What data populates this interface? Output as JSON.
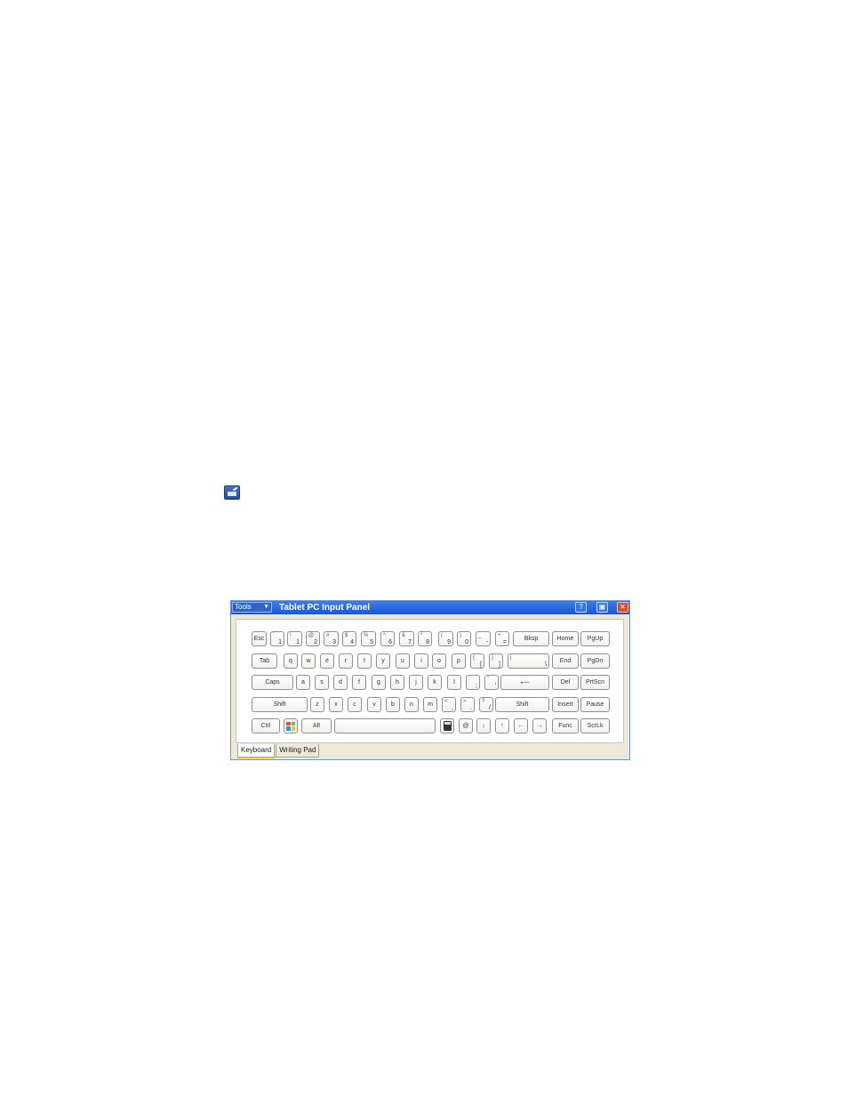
{
  "tray_icon": "input-panel-icon",
  "panel": {
    "tools_label": "Tools",
    "title": "Tablet PC Input Panel",
    "titlebar_buttons": [
      "help-icon",
      "dock-icon",
      "close-icon"
    ],
    "tabs": [
      {
        "label": "Keyboard",
        "active": true
      },
      {
        "label": "Writing Pad",
        "active": false
      }
    ]
  },
  "keyboard": {
    "row1": [
      {
        "label": "Esc"
      },
      {
        "label": "1",
        "shift": "`"
      },
      {
        "label": "1",
        "shift": "!"
      },
      {
        "label": "2",
        "shift": "@"
      },
      {
        "label": "3",
        "shift": "#"
      },
      {
        "label": "4",
        "shift": "$"
      },
      {
        "label": "5",
        "shift": "%"
      },
      {
        "label": "6",
        "shift": "^"
      },
      {
        "label": "7",
        "shift": "&"
      },
      {
        "label": "8",
        "shift": "*"
      },
      {
        "label": "9",
        "shift": "("
      },
      {
        "label": "0",
        "shift": ")"
      },
      {
        "label": "-",
        "shift": "_"
      },
      {
        "label": "=",
        "shift": "+"
      },
      {
        "label": "Bksp"
      },
      {
        "label": "Home"
      },
      {
        "label": "PgUp"
      }
    ],
    "row2": [
      {
        "label": "Tab"
      },
      {
        "label": "q"
      },
      {
        "label": "w"
      },
      {
        "label": "e"
      },
      {
        "label": "r"
      },
      {
        "label": "t"
      },
      {
        "label": "y"
      },
      {
        "label": "u"
      },
      {
        "label": "i"
      },
      {
        "label": "o"
      },
      {
        "label": "p"
      },
      {
        "label": "[",
        "shift": "{"
      },
      {
        "label": "]",
        "shift": "}"
      },
      {
        "label": "\\",
        "shift": "|"
      },
      {
        "label": "End"
      },
      {
        "label": "PgDn"
      }
    ],
    "row3": [
      {
        "label": "Caps"
      },
      {
        "label": "a"
      },
      {
        "label": "s"
      },
      {
        "label": "d"
      },
      {
        "label": "f"
      },
      {
        "label": "g"
      },
      {
        "label": "h"
      },
      {
        "label": "j"
      },
      {
        "label": "k"
      },
      {
        "label": "l"
      },
      {
        "label": ";",
        "shift": ":"
      },
      {
        "label": "'",
        "shift": "\""
      },
      {
        "label": "⟵"
      },
      {
        "label": "Del"
      },
      {
        "label": "PrtScn"
      }
    ],
    "row4": [
      {
        "label": "Shift"
      },
      {
        "label": "z"
      },
      {
        "label": "x"
      },
      {
        "label": "c"
      },
      {
        "label": "v"
      },
      {
        "label": "b"
      },
      {
        "label": "n"
      },
      {
        "label": "m"
      },
      {
        "label": ",",
        "shift": "<"
      },
      {
        "label": ".",
        "shift": ">"
      },
      {
        "label": "/",
        "shift": "?"
      },
      {
        "label": "Shift"
      },
      {
        "label": "Insert"
      },
      {
        "label": "Pause"
      }
    ],
    "row5": [
      {
        "label": "Ctrl"
      },
      {
        "label": "",
        "icon": "windows-logo-icon"
      },
      {
        "label": "Alt"
      },
      {
        "label": ""
      },
      {
        "label": "",
        "icon": "calculator-icon"
      },
      {
        "label": "@"
      },
      {
        "label": "↓"
      },
      {
        "label": "↑"
      },
      {
        "label": "←"
      },
      {
        "label": "→"
      },
      {
        "label": "Func"
      },
      {
        "label": "ScrLk"
      }
    ]
  },
  "colors": {
    "titlebar": "#1b56d4",
    "panel_bg": "#ece9d8",
    "close_button": "#d9502c",
    "active_tab_accent": "#f0b030"
  }
}
